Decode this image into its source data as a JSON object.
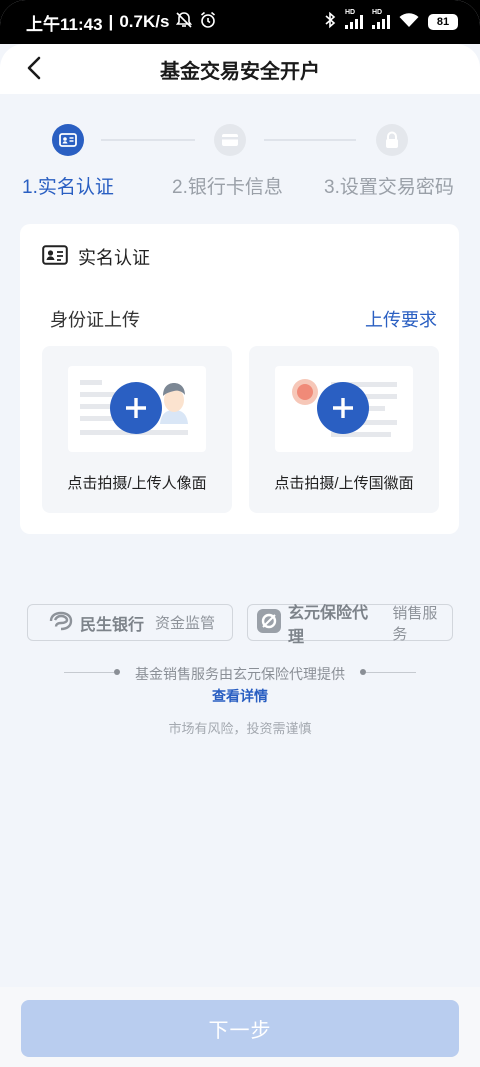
{
  "status_bar": {
    "time": "上午11:43",
    "speed": "0.7K/s",
    "sim1_tag": "HD",
    "sim2_tag": "HD",
    "battery": "81"
  },
  "header": {
    "title": "基金交易安全开户"
  },
  "stepper": {
    "steps": [
      {
        "label": "1.实名认证",
        "state": "active"
      },
      {
        "label": "2.银行卡信息",
        "state": "inactive"
      },
      {
        "label": "3.设置交易密码",
        "state": "inactive"
      }
    ]
  },
  "card": {
    "title": "实名认证",
    "upload_label": "身份证上传",
    "requirements_link": "上传要求",
    "front_caption": "点击拍摄/上传人像面",
    "back_caption": "点击拍摄/上传国徽面"
  },
  "partners": {
    "bank_name": "民生银行",
    "bank_tag": "资金监管",
    "agency_name": "玄元保险代理",
    "agency_tag": "销售服务"
  },
  "footer_note": {
    "provider": "基金销售服务由玄元保险代理提供",
    "detail_link": "查看详情",
    "risk": "市场有风险，投资需谨慎"
  },
  "bottom": {
    "next_button": "下一步"
  },
  "colors": {
    "accent": "#2a5fc2",
    "inactive": "#9aa0a8",
    "button_disabled": "#b9cdef",
    "background": "#f2f5fa"
  }
}
